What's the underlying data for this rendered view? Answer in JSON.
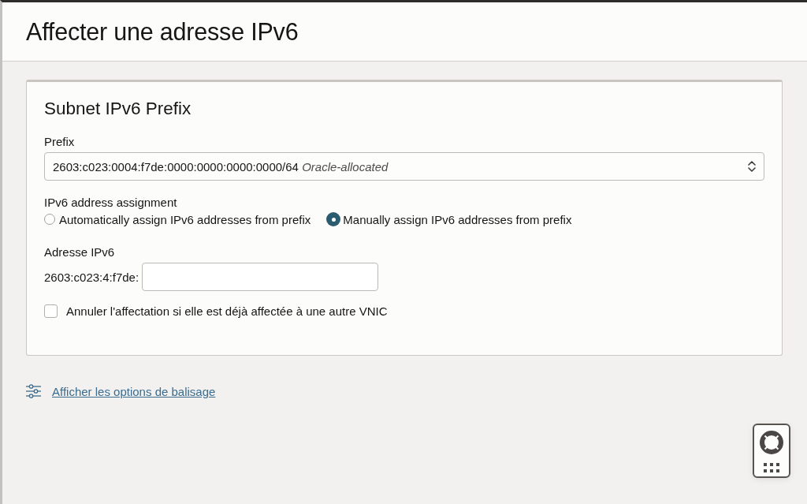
{
  "dialog": {
    "title": "Affecter une adresse IPv6"
  },
  "section": {
    "title": "Subnet IPv6 Prefix",
    "prefix": {
      "label": "Prefix",
      "value": "2603:c023:0004:f7de:0000:0000:0000:0000/64",
      "note": "Oracle-allocated"
    },
    "assignment": {
      "label": "IPv6 address assignment",
      "options": [
        {
          "label": "Automatically assign IPv6 addresses from prefix",
          "selected": false
        },
        {
          "label": "Manually assign IPv6 addresses from prefix",
          "selected": true
        }
      ]
    },
    "address": {
      "label": "Adresse IPv6",
      "prefix_text": "2603:c023:4:f7de:"
    },
    "unassign": {
      "label": "Annuler l'affectation si elle est déjà affectée à une autre VNIC",
      "checked": false
    }
  },
  "tagging_link": {
    "label": "Afficher les options de balisage"
  }
}
